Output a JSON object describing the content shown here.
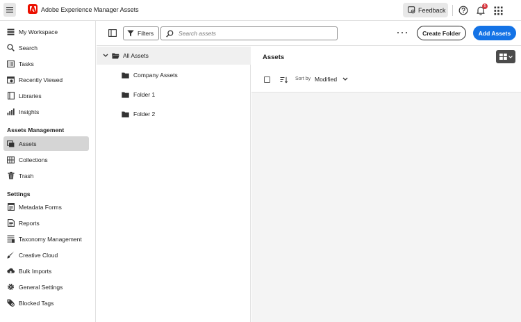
{
  "header": {
    "app_title": "Adobe Experience Manager Assets",
    "feedback_label": "Feedback",
    "notification_count": "5"
  },
  "sidebar": {
    "items_top": [
      {
        "label": "My Workspace",
        "icon": "workspace-icon"
      },
      {
        "label": "Search",
        "icon": "search-icon"
      },
      {
        "label": "Tasks",
        "icon": "tasks-icon"
      },
      {
        "label": "Recently Viewed",
        "icon": "recently-viewed-icon"
      },
      {
        "label": "Libraries",
        "icon": "libraries-icon"
      },
      {
        "label": "Insights",
        "icon": "insights-icon"
      }
    ],
    "assets_section_title": "Assets Management",
    "assets_items": [
      {
        "label": "Assets",
        "icon": "assets-icon",
        "active": true
      },
      {
        "label": "Collections",
        "icon": "collections-icon"
      },
      {
        "label": "Trash",
        "icon": "trash-icon"
      }
    ],
    "settings_section_title": "Settings",
    "settings_items": [
      {
        "label": "Metadata Forms",
        "icon": "metadata-forms-icon"
      },
      {
        "label": "Reports",
        "icon": "reports-icon"
      },
      {
        "label": "Taxonomy Management",
        "icon": "taxonomy-icon"
      },
      {
        "label": "Creative Cloud",
        "icon": "creative-cloud-icon"
      },
      {
        "label": "Bulk Imports",
        "icon": "bulk-imports-icon"
      },
      {
        "label": "General Settings",
        "icon": "gear-icon"
      },
      {
        "label": "Blocked Tags",
        "icon": "blocked-tags-icon"
      }
    ]
  },
  "toolbar": {
    "filters_label": "Filters",
    "search_placeholder": "Search assets",
    "create_folder_label": "Create Folder",
    "add_assets_label": "Add Assets"
  },
  "tree": {
    "root_label": "All Assets",
    "folders": [
      "Company Assets",
      "Folder 1",
      "Folder 2"
    ]
  },
  "content": {
    "title": "Assets",
    "sort_by_label": "Sort by",
    "sort_value": "Modified"
  },
  "colors": {
    "primary": "#1473e6",
    "adobe_red": "#eb1000",
    "active_nav": "#d5d5d5"
  }
}
